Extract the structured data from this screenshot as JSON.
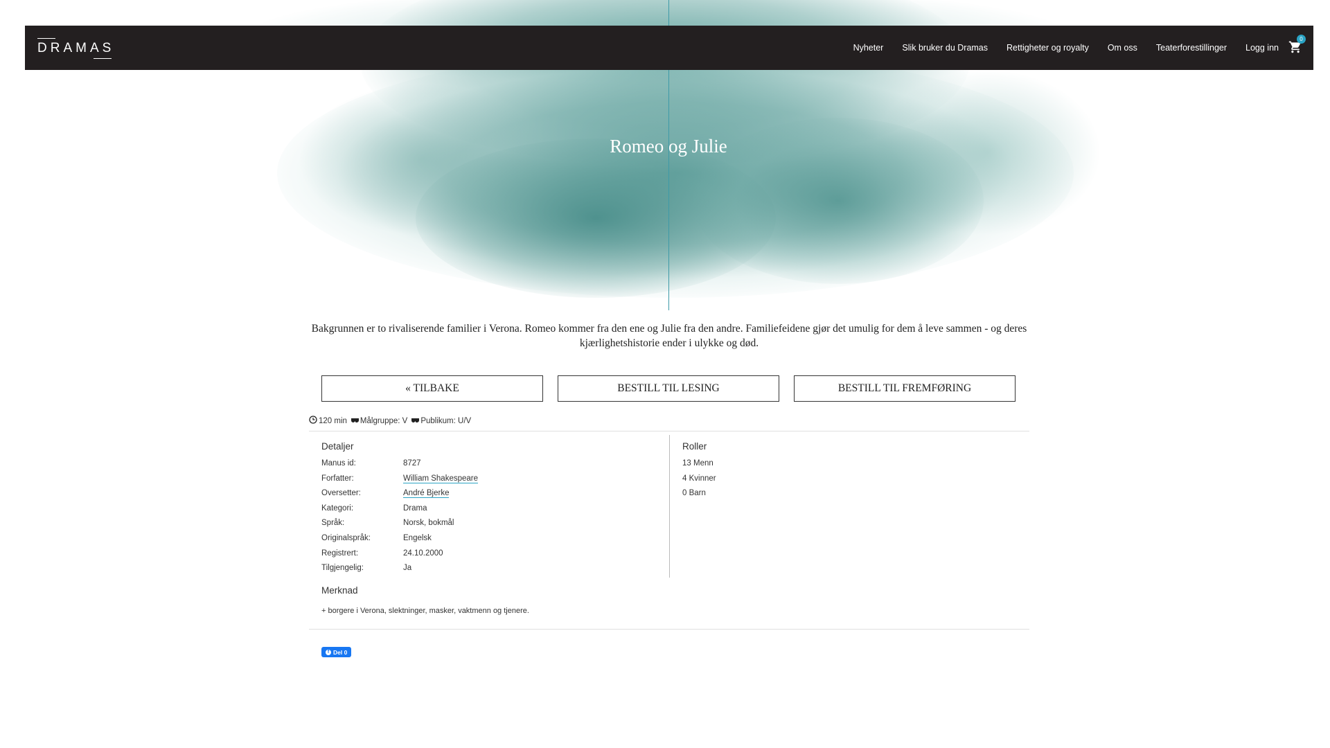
{
  "nav": {
    "logo": "DRAMAS",
    "items": [
      "Nyheter",
      "Slik bruker du Dramas",
      "Rettigheter og royalty",
      "Om oss",
      "Teaterforestillinger",
      "Logg inn"
    ],
    "cart_count": "0"
  },
  "hero": {
    "title": "Romeo og Julie"
  },
  "description": "Bakgrunnen er to rivaliserende familier i Verona. Romeo kommer fra den ene og Julie fra den andre. Familiefeidene gjør det umulig for dem å leve sammen - og deres kjærlighetshistorie ender i ulykke og død.",
  "buttons": {
    "back": "« TILBAKE",
    "order_read": "BESTILL TIL LESING",
    "order_perform": "BESTILL TIL FREMFØRING"
  },
  "meta": {
    "duration": "120 min",
    "target": "Målgruppe: V",
    "audience": "Publikum: U/V"
  },
  "details": {
    "title": "Detaljer",
    "rows": [
      {
        "label": "Manus id:",
        "value": "8727"
      },
      {
        "label": "Forfatter:",
        "value": "William Shakespeare"
      },
      {
        "label": "Oversetter:",
        "value": "André Bjerke"
      },
      {
        "label": "Kategori:",
        "value": "Drama"
      },
      {
        "label": "Språk:",
        "value": "Norsk, bokmål"
      },
      {
        "label": "Originalspråk:",
        "value": "Engelsk"
      },
      {
        "label": "Registrert:",
        "value": "24.10.2000"
      },
      {
        "label": "Tilgjengelig:",
        "value": "Ja"
      }
    ]
  },
  "roles": {
    "title": "Roller",
    "items": [
      "13 Menn",
      "4 Kvinner",
      "0 Barn"
    ]
  },
  "note": {
    "title": "Merknad",
    "text": "+ borgere i Verona, slektninger, masker, vaktmenn og tjenere."
  },
  "share": {
    "label": "Del 0"
  },
  "colors": {
    "accent": "#2aa3c4",
    "navbar": "#231f20",
    "ink": "#4c9691"
  }
}
